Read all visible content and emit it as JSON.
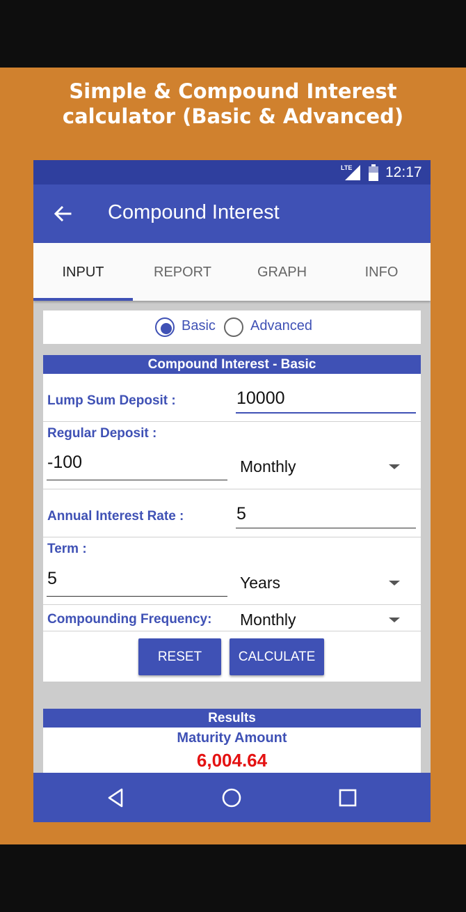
{
  "banner": {
    "title_line1": "Simple & Compound Interest",
    "title_line2": "calculator (Basic & Advanced)"
  },
  "status_bar": {
    "network": "LTE",
    "time": "12:17"
  },
  "app_bar": {
    "title": "Compound Interest"
  },
  "tabs": [
    {
      "label": "INPUT",
      "active": true
    },
    {
      "label": "REPORT",
      "active": false
    },
    {
      "label": "GRAPH",
      "active": false
    },
    {
      "label": "INFO",
      "active": false
    }
  ],
  "mode": {
    "options": [
      {
        "label": "Basic",
        "selected": true
      },
      {
        "label": "Advanced",
        "selected": false
      }
    ]
  },
  "form": {
    "header": "Compound Interest - Basic",
    "lump_sum_label": "Lump Sum Deposit :",
    "lump_sum_value": "10000",
    "regular_deposit_label": "Regular Deposit :",
    "regular_deposit_value": "-100",
    "regular_deposit_period": "Monthly",
    "rate_label": "Annual Interest Rate :",
    "rate_value": "5",
    "term_label": "Term :",
    "term_value": "5",
    "term_unit": "Years",
    "compounding_label": "Compounding Frequency:",
    "compounding_value": "Monthly",
    "reset_label": "RESET",
    "calculate_label": "CALCULATE"
  },
  "results": {
    "header": "Results",
    "maturity_label": "Maturity Amount",
    "maturity_value": "6,004.64"
  },
  "colors": {
    "banner": "#d0812e",
    "primary": "#3f51b5",
    "status_bar": "#2f3f9e",
    "result_value": "#e41212"
  }
}
